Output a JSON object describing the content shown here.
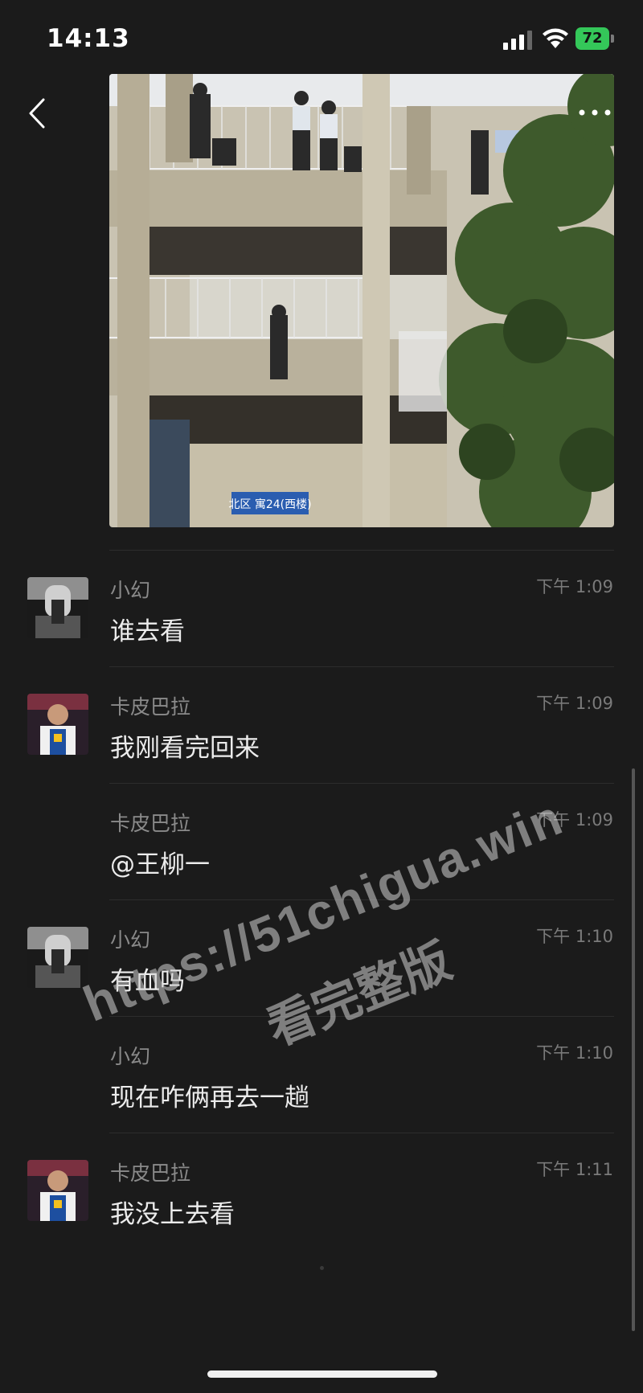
{
  "status_bar": {
    "time": "14:13",
    "battery": "72"
  },
  "header": {
    "back_icon": "chevron-left-icon",
    "more_icon": "more-horizontal-icon"
  },
  "messages": [
    {
      "name": "小幻",
      "text": "谁去看",
      "time": "下午 1:09",
      "avatar": "dark-portrait"
    },
    {
      "name": "卡皮巴拉",
      "text": "我刚看完回来",
      "time": "下午 1:09",
      "avatar": "basketball-player"
    },
    {
      "name": "卡皮巴拉",
      "text": "@王柳一",
      "time": "下午 1:09",
      "avatar": ""
    },
    {
      "name": "小幻",
      "text": "有血吗",
      "time": "下午 1:10",
      "avatar": "dark-portrait"
    },
    {
      "name": "小幻",
      "text": "现在咋俩再去一趟",
      "time": "下午 1:10",
      "avatar": ""
    },
    {
      "name": "卡皮巴拉",
      "text": "我没上去看",
      "time": "下午 1:11",
      "avatar": "basketball-player"
    }
  ],
  "photo": {
    "sign_text": "北区 寓24(西楼)"
  },
  "watermark": {
    "line1": "https://51chigua.win",
    "line2": "看完整版"
  }
}
